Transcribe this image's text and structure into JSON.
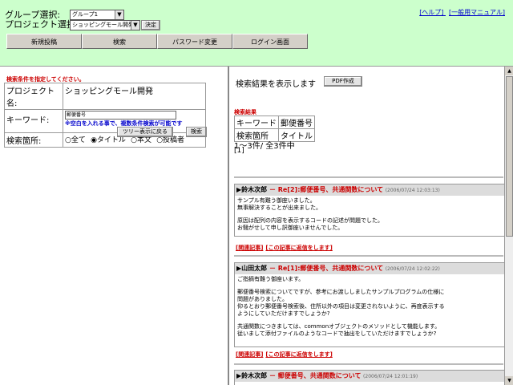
{
  "header": {
    "group_label": "グループ選択:",
    "group_value": "グループ1",
    "project_label": "プロジェクト選択:",
    "project_value": "ショッピングモール開発",
    "decide_label": "決定",
    "help_link": "[ヘルプ]",
    "manual_link": "[一般用マニュアル]"
  },
  "nav": [
    "新規投稿",
    "検索",
    "パスワード変更",
    "ログイン画面"
  ],
  "left": {
    "instruction": "検索条件を指定してください。",
    "project_name_label": "プロジェクト名:",
    "project_name_value": "ショッピングモール開発",
    "keyword_label": "キーワード:",
    "keyword_value": "郵便番号",
    "keyword_hint": "※空白を入れる事で、複数条件検索が可能です",
    "search_target_label": "検索箇所:",
    "radios": [
      "全て",
      "タイトル",
      "本文",
      "投稿者"
    ],
    "selected_radio": "タイトル",
    "tree_button": "ツリー表示に戻る",
    "search_button": "検索"
  },
  "right": {
    "show_results": "検索結果を表示します",
    "pdf_button": "PDF作成",
    "results_title": "検索結果",
    "kw_label": "キーワード",
    "kw_value": "郵便番号",
    "target_label": "検索箇所",
    "target_value": "タイトル",
    "count": "1～3件/  全3件中",
    "pager": "[1]",
    "posts": [
      {
        "author": "鈴木次郎",
        "subject": " － Re[2]:郵便番号、共通関数について",
        "date": "(2006/07/24 12:03:13)",
        "body": [
          "サンプル有難う御座いました。\n無事解決することが出来ました。",
          "原因は配列の内容を表示するコードの記述が問題でした。\nお騒がせして申し訳御座いませんでした。"
        ],
        "link1": "[関連記事]",
        "link2": "[この記事に返信をします]"
      },
      {
        "author": "山田太郎",
        "subject": " － Re[1]:郵便番号、共通関数について",
        "date": "(2006/07/24 12:02:22)",
        "body": [
          "ご指摘有難う御座います。",
          "郵便番号検索についてですが、参考にお渡ししましたサンプルプログラムの仕様に\n問題がありました。\n仰るとおり郵便番号検索後、住所以外の項目は変更されないように、再度表示する\nようにしていただけますでしょうか?",
          "共通関数につきましては、commonオブジェクトのメソッドとして機能します。\n従いまして添付ファイルのようなコードで抽出をしていただけますでしょうか?"
        ],
        "link1": "[関連記事]",
        "link2": "[この記事に返信をします]"
      },
      {
        "author": "鈴木次郎",
        "subject": " － 郵便番号、共通関数について",
        "date": "(2006/07/24 12:01:19)"
      }
    ]
  }
}
